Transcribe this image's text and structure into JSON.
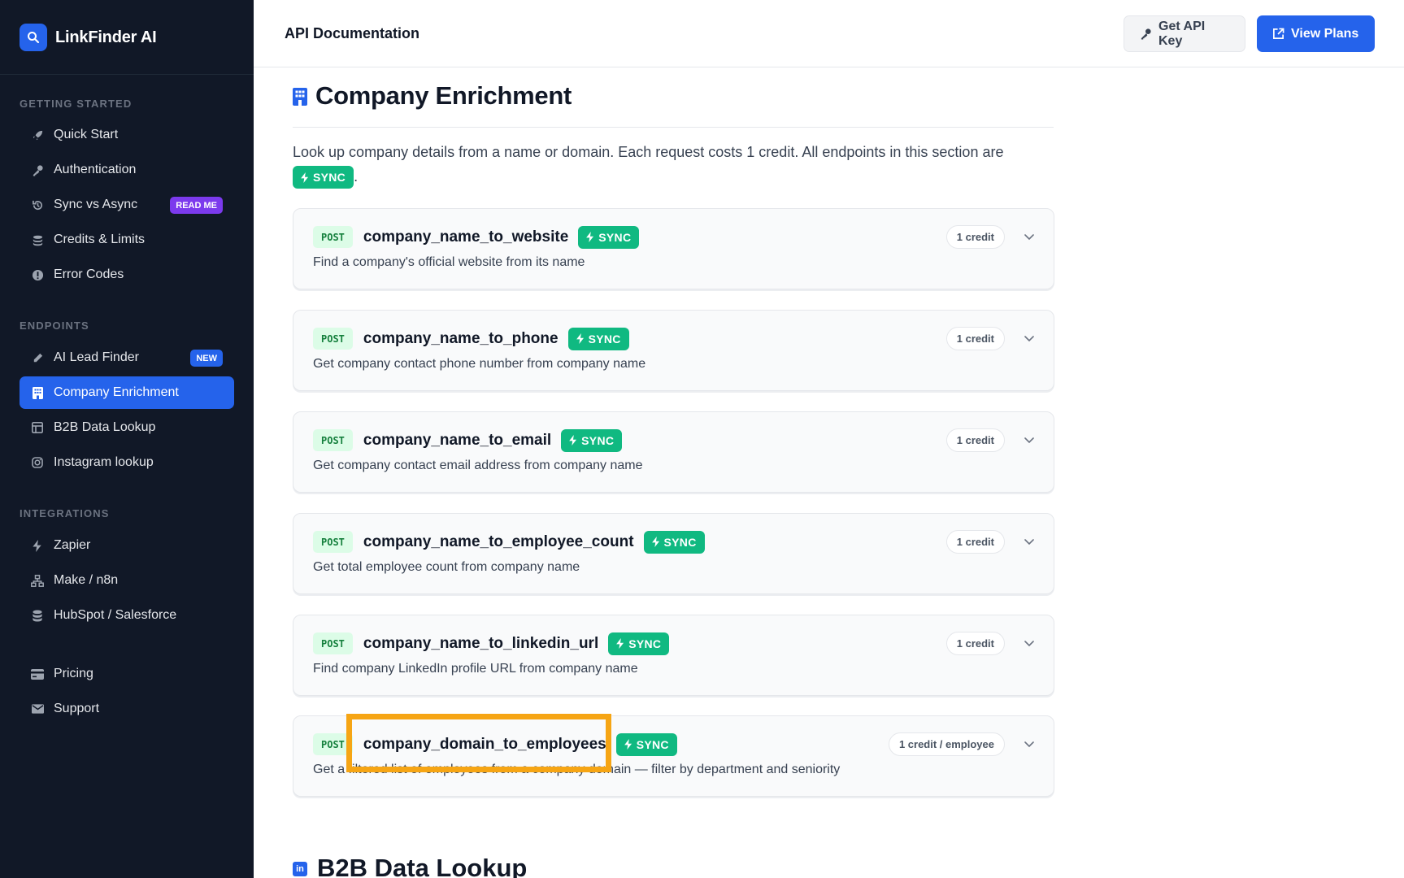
{
  "brand": {
    "name": "LinkFinder AI",
    "logo_icon": "search-icon",
    "accent": "#2563eb"
  },
  "sidebar": {
    "sections": [
      {
        "label": "GETTING STARTED",
        "items": [
          {
            "label": "Quick Start",
            "icon": "rocket-icon"
          },
          {
            "label": "Authentication",
            "icon": "key-icon"
          },
          {
            "label": "Sync vs Async",
            "icon": "history-icon",
            "badge": "READ ME"
          },
          {
            "label": "Credits & Limits",
            "icon": "coins-icon"
          },
          {
            "label": "Error Codes",
            "icon": "alert-circle-icon"
          }
        ]
      },
      {
        "label": "ENDPOINTS",
        "items": [
          {
            "label": "AI Lead Finder",
            "icon": "pencil-icon",
            "badge": "NEW"
          },
          {
            "label": "Company Enrichment",
            "icon": "building-icon",
            "active": true
          },
          {
            "label": "B2B Data Lookup",
            "icon": "table-icon"
          },
          {
            "label": "Instagram lookup",
            "icon": "instagram-icon"
          }
        ]
      },
      {
        "label": "INTEGRATIONS",
        "items": [
          {
            "label": "Zapier",
            "icon": "bolt-icon"
          },
          {
            "label": "Make / n8n",
            "icon": "sitemap-icon"
          },
          {
            "label": "HubSpot / Salesforce",
            "icon": "database-icon"
          }
        ]
      },
      {
        "label": "",
        "items": [
          {
            "label": "Pricing",
            "icon": "credit-card-icon"
          },
          {
            "label": "Support",
            "icon": "envelope-icon"
          }
        ]
      }
    ]
  },
  "header": {
    "title": "API Documentation",
    "get_api_key": "Get API Key",
    "view_plans": "View Plans"
  },
  "section": {
    "title": "Company Enrichment",
    "description_before": "Look up company details from a name or domain. Each request costs 1 credit. All endpoints in this section are",
    "description_after": ".",
    "sync_label": "SYNC"
  },
  "endpoints": [
    {
      "method": "POST",
      "name": "company_name_to_website",
      "mode": "SYNC",
      "description": "Find a company's official website from its name",
      "credit": "1 credit"
    },
    {
      "method": "POST",
      "name": "company_name_to_phone",
      "mode": "SYNC",
      "description": "Get company contact phone number from company name",
      "credit": "1 credit"
    },
    {
      "method": "POST",
      "name": "company_name_to_email",
      "mode": "SYNC",
      "description": "Get company contact email address from company name",
      "credit": "1 credit"
    },
    {
      "method": "POST",
      "name": "company_name_to_employee_count",
      "mode": "SYNC",
      "description": "Get total employee count from company name",
      "credit": "1 credit"
    },
    {
      "method": "POST",
      "name": "company_name_to_linkedin_url",
      "mode": "SYNC",
      "description": "Find company LinkedIn profile URL from company name",
      "credit": "1 credit"
    },
    {
      "method": "POST",
      "name": "company_domain_to_employees",
      "mode": "SYNC",
      "description": "Get a filtered list of employees from a company domain — filter by department and seniority",
      "credit": "1 credit / employee"
    }
  ],
  "next_section": {
    "title": "B2B Data Lookup",
    "icon": "linkedin-icon"
  },
  "colors": {
    "sidebar_bg": "#111827",
    "sync": "#10b981",
    "post_bg": "#dcfce7",
    "highlight": "#f6a514"
  }
}
